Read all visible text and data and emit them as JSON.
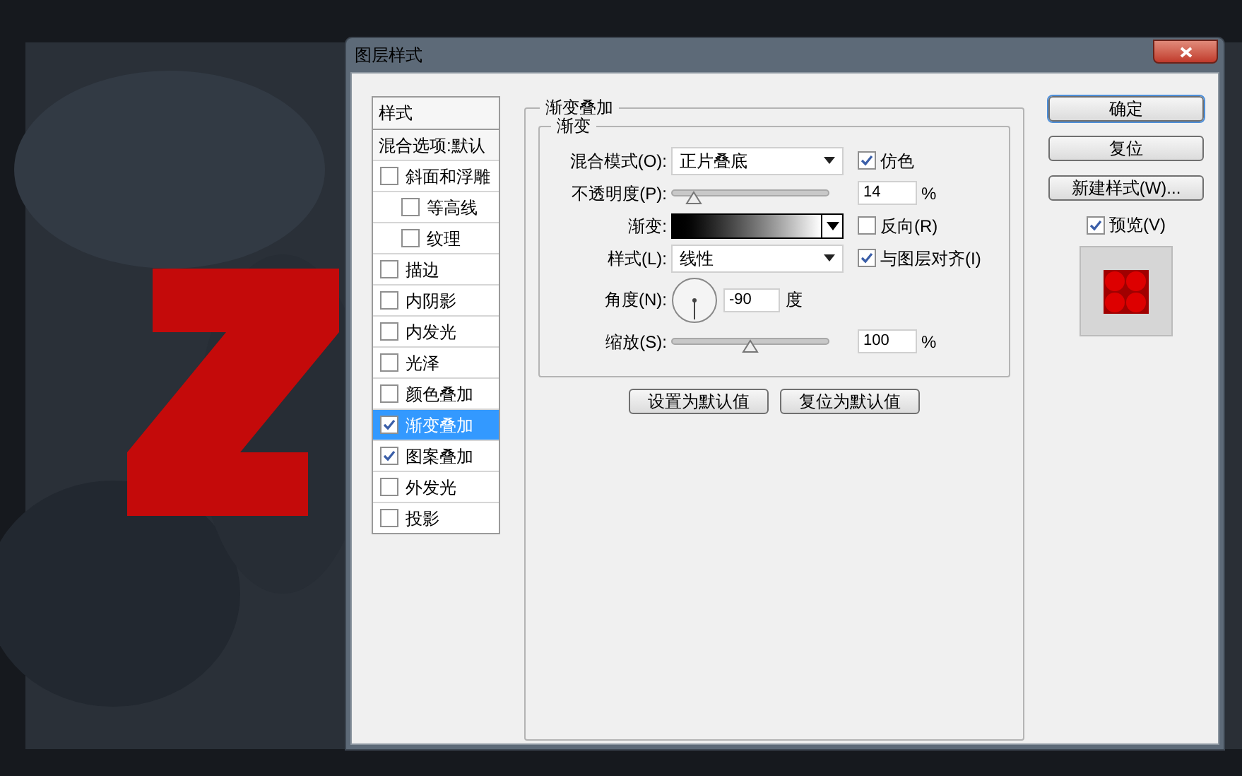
{
  "window": {
    "title": "图层样式"
  },
  "styles_list": {
    "header": "样式",
    "blend_options": "混合选项:默认",
    "items": [
      {
        "label": "斜面和浮雕",
        "checked": false,
        "selected": false,
        "children": [
          {
            "label": "等高线",
            "checked": false,
            "selected": false
          },
          {
            "label": "纹理",
            "checked": false,
            "selected": false
          }
        ]
      },
      {
        "label": "描边",
        "checked": false,
        "selected": false
      },
      {
        "label": "内阴影",
        "checked": false,
        "selected": false
      },
      {
        "label": "内发光",
        "checked": false,
        "selected": false
      },
      {
        "label": "光泽",
        "checked": false,
        "selected": false
      },
      {
        "label": "颜色叠加",
        "checked": false,
        "selected": false
      },
      {
        "label": "渐变叠加",
        "checked": true,
        "selected": true
      },
      {
        "label": "图案叠加",
        "checked": true,
        "selected": false
      },
      {
        "label": "外发光",
        "checked": false,
        "selected": false
      },
      {
        "label": "投影",
        "checked": false,
        "selected": false
      }
    ]
  },
  "panel": {
    "title": "渐变叠加",
    "group_title": "渐变",
    "blend_mode": {
      "label": "混合模式(O):",
      "value": "正片叠底"
    },
    "dither": {
      "label": "仿色",
      "checked": true
    },
    "opacity": {
      "label": "不透明度(P):",
      "level": 0.14,
      "value": "14",
      "unit": "%"
    },
    "gradient": {
      "label": "渐变:"
    },
    "reverse": {
      "label": "反向(R)",
      "checked": false
    },
    "style": {
      "label": "样式(L):",
      "value": "线性"
    },
    "align": {
      "label": "与图层对齐(I)",
      "checked": true
    },
    "angle": {
      "label": "角度(N):",
      "value": "-90",
      "unit": "度"
    },
    "scale": {
      "label": "缩放(S):",
      "level": 0.5,
      "value": "100",
      "unit": "%"
    },
    "buttons": [
      "设置为默认值",
      "复位为默认值"
    ]
  },
  "actions": [
    "确定",
    "复位",
    "新建样式(W)..."
  ],
  "preview": {
    "label": "预览(V)",
    "checked": true
  }
}
